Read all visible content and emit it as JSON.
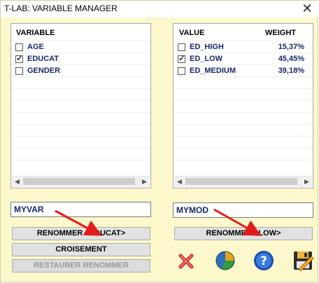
{
  "window": {
    "title": "T-LAB: VARIABLE MANAGER"
  },
  "variables": {
    "header": "VARIABLE",
    "items": [
      {
        "label": "AGE",
        "checked": false
      },
      {
        "label": "EDUCAT",
        "checked": true
      },
      {
        "label": "GENDER",
        "checked": false
      }
    ]
  },
  "values": {
    "header_value": "VALUE",
    "header_weight": "WEIGHT",
    "items": [
      {
        "label": "ED_HIGH",
        "weight": "15,37%",
        "checked": false
      },
      {
        "label": "ED_LOW",
        "weight": "45,45%",
        "checked": true
      },
      {
        "label": "ED_MEDIUM",
        "weight": "39,18%",
        "checked": false
      }
    ]
  },
  "fields": {
    "var_name": "MYVAR",
    "mod_name": "MYMOD"
  },
  "buttons": {
    "rename_variable": "RENOMMER <EDUCAT>",
    "crossing": "CROISEMENT",
    "restore": "RESTAURER RENOMMER",
    "rename_value": "RENOMMER <LOW>"
  },
  "colors": {
    "window_bg": "#fcf8cc",
    "item_text": "#17276c",
    "annotation_arrow": "#e41b1b"
  },
  "icons": [
    "close-icon",
    "delete-icon",
    "chart-icon",
    "help-icon",
    "save-icon"
  ]
}
